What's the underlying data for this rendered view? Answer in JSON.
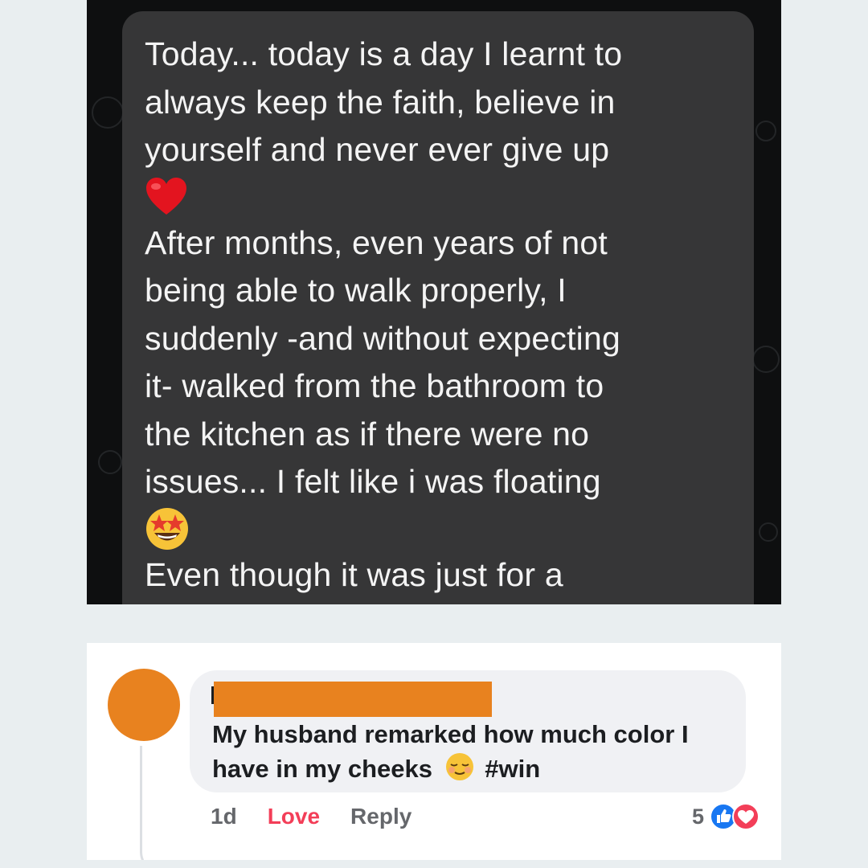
{
  "chat_message": {
    "lines_1": [
      "Today... today is a day I learnt to",
      "always keep the faith, believe in",
      "yourself and never ever give up"
    ],
    "lines_2": [
      "After months, even years of not",
      "being able to walk properly, I",
      "suddenly -and without expecting",
      "it- walked from the bathroom to",
      "the kitchen as if there were no",
      "issues... I felt like i was floating"
    ],
    "lines_3": [
      "Even though it was just for a"
    ],
    "emoji_1": "heart-icon",
    "emoji_2": "starstruck-icon"
  },
  "comment": {
    "text_part1": "My husband remarked how much color I have in my cheeks",
    "emoji": "relieved-icon",
    "text_part2": "#win",
    "timestamp": "1d",
    "love_label": "Love",
    "reply_label": "Reply",
    "reaction_count": "5",
    "reactions": [
      "like-icon",
      "love-icon"
    ],
    "redaction_color": "#e8821f",
    "avatar_color": "#e8821f"
  },
  "colors": {
    "chat_background": "#0e0f10",
    "chat_bubble": "#363637",
    "love_red": "#f33e58",
    "like_blue": "#1877f2"
  }
}
